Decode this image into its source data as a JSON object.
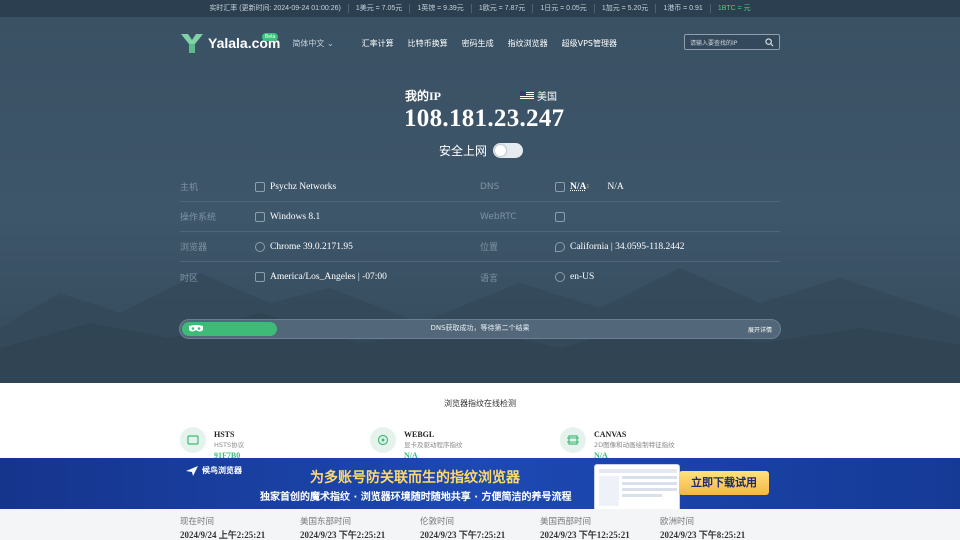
{
  "ticker": {
    "items": [
      "实时汇率 (更新时间: 2024-09-24 01:00:26)",
      "1美元 = 7.05元",
      "1英镑 = 9.39元",
      "1欧元 = 7.87元",
      "1日元 = 0.05元",
      "1加元 = 5.20元",
      "1港币 = 0.91"
    ],
    "btc": "1BTC = 元"
  },
  "nav": {
    "logo_text": "Yalala.com",
    "beta": "Beta",
    "lang": "简体中文",
    "menu": [
      "汇率计算",
      "比特币换算",
      "密码生成",
      "指纹浏览器",
      "超级VPS管理器"
    ],
    "search_placeholder": "请输入要查找的IP"
  },
  "ip_info": {
    "my_ip_label": "我的IP",
    "country": "美国",
    "ip": "108.181.23.247",
    "safe_label": "安全上网",
    "safe_on": false
  },
  "details": {
    "left": [
      {
        "label": "主机",
        "icon": "file-icon",
        "value": "Psychz Networks"
      },
      {
        "label": "操作系统",
        "icon": "monitor-icon",
        "value": "Windows 8.1"
      },
      {
        "label": "浏览器",
        "icon": "globe-icon",
        "value": "Chrome 39.0.2171.95"
      },
      {
        "label": "时区",
        "icon": "clock-icon",
        "value": "America/Los_Angeles | -07:00"
      }
    ],
    "right": [
      {
        "label": "DNS",
        "icon": "network-icon",
        "value": "N/A",
        "sup": "1",
        "extra": "N/A"
      },
      {
        "label": "WebRTC",
        "icon": "cube-icon",
        "value": ""
      },
      {
        "label": "位置",
        "icon": "pin-icon",
        "value": "California | 34.0595-118.2442"
      },
      {
        "label": "语言",
        "icon": "chat-icon",
        "value": "en-US"
      }
    ]
  },
  "progress": {
    "message": "DNS获取成功，等待第二个结果",
    "more": "展开详情",
    "fraction": 0.16
  },
  "fingerprint": {
    "title": "浏览器指纹在线检测",
    "items": [
      {
        "name": "HSTS",
        "desc": "HSTS协议",
        "result": "91F7B0"
      },
      {
        "name": "WEBGL",
        "desc": "显卡及驱动程序指纹",
        "result": "N/A"
      },
      {
        "name": "CANVAS",
        "desc": "2D图像和动画绘制特征指纹",
        "result": "N/A"
      }
    ]
  },
  "banner": {
    "brand": "候鸟浏览器",
    "headline": "为多账号防关联而生的指纹浏览器",
    "subline": "独家首创的魔术指纹 · 浏览器环境随时随地共享 · 方便简洁的养号流程",
    "cta": "立即下载试用"
  },
  "times": [
    {
      "label": "现在时间",
      "value": "2024/9/24 上午2:25:21"
    },
    {
      "label": "美国东部时间",
      "value": "2024/9/23 下午2:25:21"
    },
    {
      "label": "伦敦时间",
      "value": "2024/9/23 下午7:25:21"
    },
    {
      "label": "美国西部时间",
      "value": "2024/9/23 下午12:25:21"
    },
    {
      "label": "欧洲时间",
      "value": "2024/9/23 下午8:25:21"
    }
  ],
  "colors": {
    "accent": "#3dbb77",
    "hero": "#3e566a",
    "banner": "#1d49b3"
  }
}
